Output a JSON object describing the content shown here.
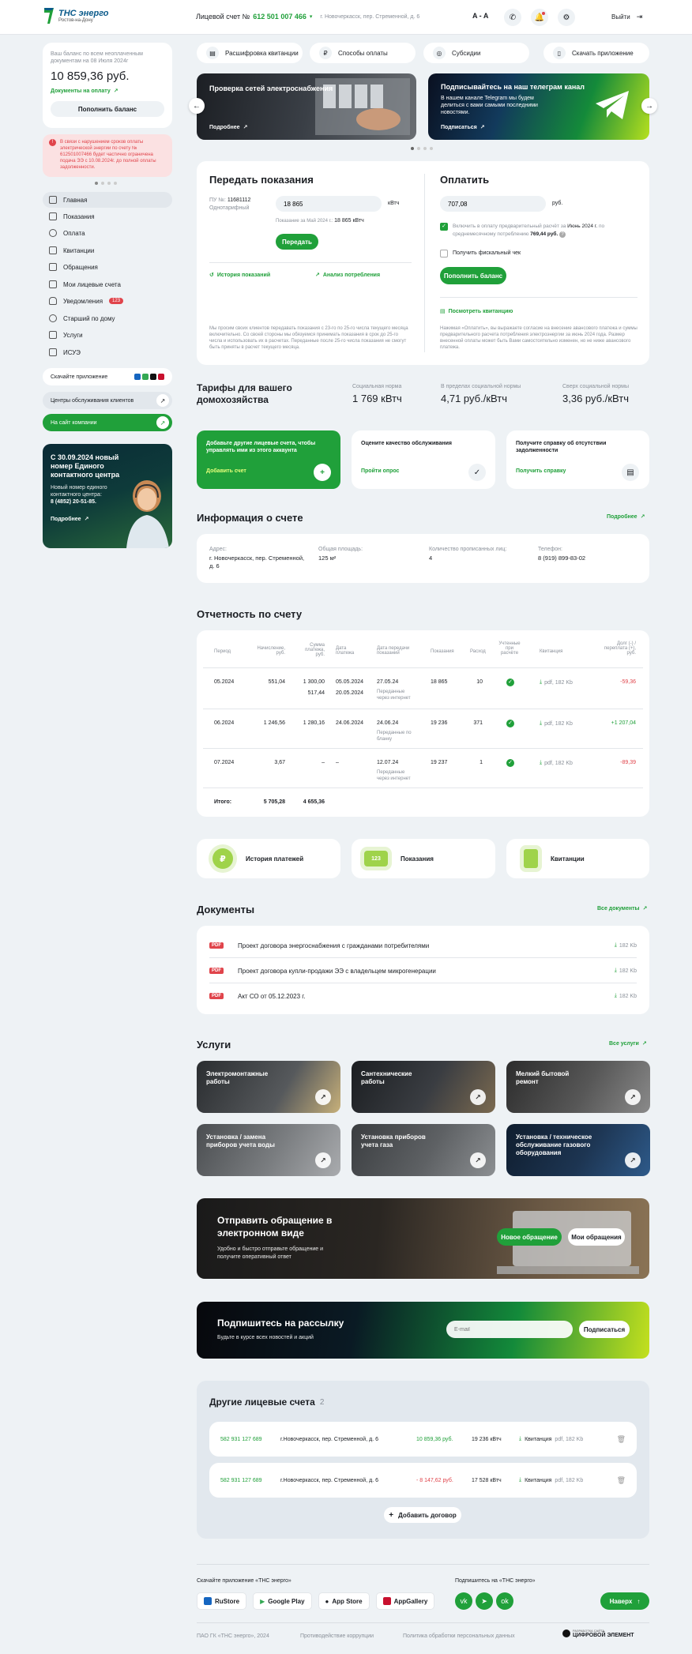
{
  "header": {
    "logo_main": "ТНС энерго",
    "logo_sub": "Ростов-на-Дону",
    "account_label": "Лицевой счет №",
    "account_number": "612 501 007 466",
    "address": "г. Новочеркасск, пер. Стременной, д. 6",
    "font_toggle": "A - A",
    "logout": "Выйти"
  },
  "balance": {
    "caption": "Ваш баланс по всем неоплаченным документам на 08 Июля 2024г",
    "amount": "10 859,36 руб.",
    "docs_link": "Документы на оплату",
    "topup_button": "Пополнить баланс"
  },
  "alert": {
    "text": "В связи с нарушением сроков оплаты электрической энергии по счету № 612501007466 будет частично ограничена подача ЭЭ с 10.08.2024г. до полной оплаты задолженности."
  },
  "menu": [
    "Главная",
    "Показания",
    "Оплата",
    "Квитанции",
    "Обращения",
    "Мои лицевые счета",
    "Уведомления",
    "Старший по дому",
    "Услуги",
    "ИСУЭ"
  ],
  "notifications_badge": "123",
  "sidebar_links": {
    "download_app": "Скачайте приложение",
    "service_centers": "Центры обслуживания клиентов",
    "company_site": "На сайт компании"
  },
  "promo": {
    "title": "С 30.09.2024 новый номер Единого контактного центра",
    "text": "Новый номер единого контактного центра:",
    "phone": "8 (4852) 20-51-85.",
    "more": "Подробнее"
  },
  "tabs": [
    "Расшифровка квитанции",
    "Способы оплаты",
    "Субсидии",
    "Скачать приложение"
  ],
  "banners": [
    {
      "title": "Проверка сетей электроснабжения",
      "link": "Подробнее"
    },
    {
      "title": "Подписывайтесь на наш телеграм канал",
      "text": "В нашем канале Telegram мы будем делиться с вами самыми последними новостями.",
      "link": "Подписаться"
    }
  ],
  "readings": {
    "title": "Передать показания",
    "meter_label": "ПУ №:",
    "meter_number": "11681112",
    "meter_type": "Однотарифный",
    "value": "18 865",
    "unit": "кВтч",
    "previous_label": "Показание за Май 2024 г.:",
    "previous_value": "18 865 кВтч",
    "submit": "Передать",
    "history_link": "История показаний",
    "analysis_link": "Анализ потребления",
    "note": "Мы просим своих клиентов передавать показания с 23-го по 25-го числа текущего месяца включительно. Со своей стороны мы обязуемся принимать показания в срок до 25-го числа и использовать их в расчетах. Переданные после 25-го числа показания не смогут быть приняты в расчет текущего месяца."
  },
  "payment": {
    "title": "Оплатить",
    "value": "707,08",
    "unit": "руб.",
    "prepay_text": "Включить в оплату предварительный расчёт за",
    "prepay_month": "Июнь 2024 г.",
    "prepay_text2": "по среднемесячному потреблению",
    "prepay_amount": "769,44 руб.",
    "receipt_label": "Получить фискальный чек",
    "topup_button": "Пополнить баланс",
    "view_receipt": "Посмотреть квитанцию",
    "note": "Нажимая «Оплатить», вы выражаете согласие на внесение авансового платежа и суммы предварительного расчета потребления электроэнергии за июнь 2024 года. Размер внесенной оплаты может быть Вами самостоятельно изменен, но не ниже авансового платежа."
  },
  "tariffs": {
    "title": "Тарифы для вашего домохозяйства",
    "items": [
      {
        "label": "Социальная норма",
        "value": "1 769 кВтч"
      },
      {
        "label": "В пределах социальной нормы",
        "value": "4,71 руб./кВтч"
      },
      {
        "label": "Сверх социальной нормы",
        "value": "3,36 руб./кВтч"
      }
    ]
  },
  "action_cards": [
    {
      "title": "Добавьте другие лицевые счета, чтобы управлять ими из этого аккаунта",
      "link": "Добавить счет"
    },
    {
      "title": "Оцените качество обслуживания",
      "link": "Пройти опрос"
    },
    {
      "title": "Получите справку об отсутствии задолженности",
      "link": "Получить справку"
    }
  ],
  "account_info": {
    "title": "Информация о счете",
    "more": "Подробнее",
    "fields": [
      {
        "label": "Адрес:",
        "value": "г. Новочеркасск, пер. Стременной, д. 6"
      },
      {
        "label": "Общая площадь:",
        "value": "125 м²"
      },
      {
        "label": "Количество прописанных лиц:",
        "value": "4"
      },
      {
        "label": "Телефон:",
        "value": "8 (919) 899-83-02"
      }
    ]
  },
  "report": {
    "title": "Отчетность по счету",
    "headers": [
      "Период",
      "Начисление, руб.",
      "Сумма платежа, руб.",
      "Дата платежа",
      "Дата передачи показаний",
      "Показания",
      "Расход",
      "Учтенные при расчёте",
      "Квитанция",
      "Долг (-) / переплата (+), руб."
    ],
    "rows": [
      {
        "period": "05.2024",
        "charge": "551,04",
        "pay1": "1 300,00",
        "pay2": "517,44",
        "date1": "05.05.2024",
        "date2": "20.05.2024",
        "rdate": "27.05.24",
        "rmethod": "Переданные через интернет",
        "reading": "18 865",
        "usage": "10",
        "file": "pdf, 182 Kb",
        "balance": "-59,36",
        "bal_color": "red"
      },
      {
        "period": "06.2024",
        "charge": "1 246,56",
        "pay1": "1 280,16",
        "pay2": "",
        "date1": "24.06.2024",
        "date2": "",
        "rdate": "24.06.24",
        "rmethod": "Переданные по бланку",
        "reading": "19 236",
        "usage": "371",
        "file": "pdf, 182 Kb",
        "balance": "+1 207,04",
        "bal_color": "green"
      },
      {
        "period": "07.2024",
        "charge": "3,67",
        "pay1": "–",
        "pay2": "",
        "date1": "–",
        "date2": "",
        "rdate": "12.07.24",
        "rmethod": "Переданные через интернет",
        "reading": "19 237",
        "usage": "1",
        "file": "pdf, 182 Kb",
        "balance": "-89,39",
        "bal_color": "red"
      }
    ],
    "total_label": "Итого:",
    "total_charge": "5 705,28",
    "total_pay": "4 655,36"
  },
  "quick_links": [
    "История платежей",
    "Показания",
    "Квитанции"
  ],
  "documents": {
    "title": "Документы",
    "all": "Все документы",
    "items": [
      {
        "name": "Проект договора энергоснабжения с гражданами потребителями",
        "size": "182 Kb"
      },
      {
        "name": "Проект договора купли-продажи ЭЭ с владельцем микрогенерации",
        "size": "182 Kb"
      },
      {
        "name": "Акт СО от 05.12.2023 г.",
        "size": "182 Kb"
      }
    ],
    "pdf_tag": "PDF"
  },
  "services": {
    "title": "Услуги",
    "all": "Все услуги",
    "items": [
      "Электромонтажные работы",
      "Сантехнические работы",
      "Мелкий бытовой ремонт",
      "Установка / замена приборов учета воды",
      "Установка приборов учета газа",
      "Установка / техническое обслуживание газового оборудования"
    ]
  },
  "appeal": {
    "title": "Отправить обращение в электронном виде",
    "text": "Удобно и быстро отправьте обращение и получите оперативный ответ",
    "new_button": "Новое обращение",
    "my_button": "Мои обращения"
  },
  "newsletter": {
    "title": "Подпишитесь на рассылку",
    "text": "Будьте в курсе всех новостей и акций",
    "placeholder": "E-mail",
    "button": "Подписаться"
  },
  "other_accounts": {
    "title": "Другие лицевые счета",
    "count": "2",
    "items": [
      {
        "number": "582 931 127 689",
        "address": "г.Новочеркасск, пер. Стременной, д. 6",
        "balance": "10 859,36 руб.",
        "bal_color": "green",
        "usage": "19 236 кВтч",
        "receipt": "Квитанция",
        "size": "pdf, 182 Kb"
      },
      {
        "number": "582 931 127 689",
        "address": "г.Новочеркасск, пер. Стременной, д. 6",
        "balance": "- 8 147,62 руб.",
        "bal_color": "red",
        "usage": "17 528 кВтч",
        "receipt": "Квитанция",
        "size": "pdf, 182 Kb"
      }
    ],
    "add_button": "Добавить договор"
  },
  "footer": {
    "app_label": "Скачайте приложение «ТНС энерго»",
    "stores": [
      "RuStore",
      "Google Play",
      "App Store",
      "AppGallery"
    ],
    "social_label": "Подпишитесь на «ТНС энерго»",
    "top_button": "Наверх",
    "copyright": "ПАО ГК «ТНС энерго», 2024",
    "anticorruption": "Противодействие коррупции",
    "privacy": "Политика обработки персональных данных",
    "dev_small": "РАЗРАБОТКА САЙТА",
    "dev": "ЦИФРОВОЙ ЭЛЕМЕНТ"
  },
  "colors": {
    "accent": "#20a03a",
    "danger": "#e0444b",
    "background": "#eef2f5"
  }
}
